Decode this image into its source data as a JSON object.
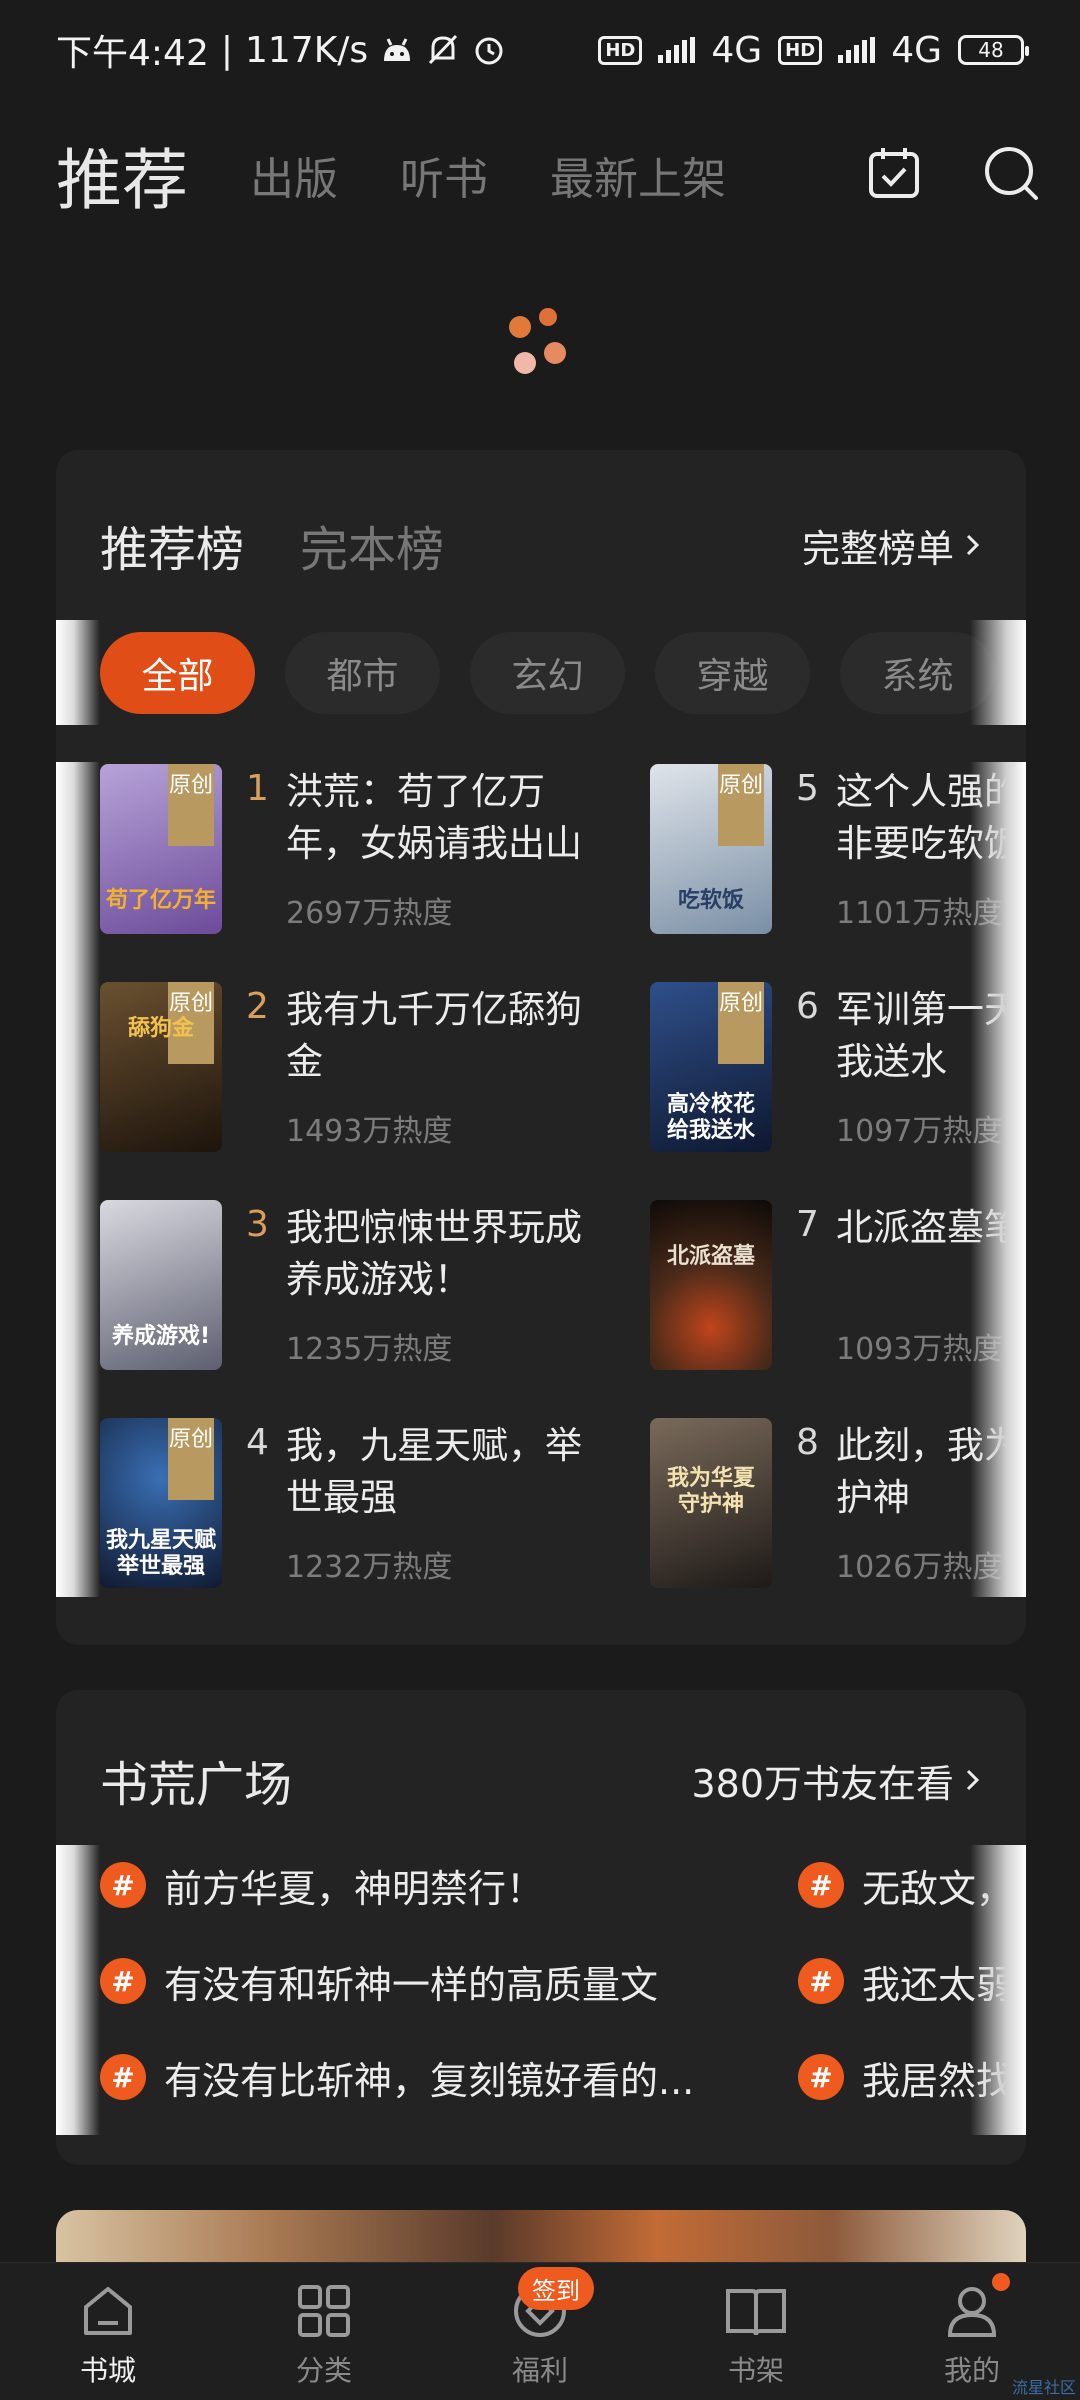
{
  "status_bar": {
    "time": "下午4:42",
    "net_speed": "117K/s",
    "net1": "4G",
    "net2": "4G",
    "hd": "HD",
    "battery": "48"
  },
  "top_tabs": [
    {
      "label": "推荐",
      "active": true
    },
    {
      "label": "出版"
    },
    {
      "label": "听书"
    },
    {
      "label": "最新上架"
    }
  ],
  "rank": {
    "tabs": [
      "推荐榜",
      "完本榜"
    ],
    "more_label": "完整榜单",
    "chips": [
      "全部",
      "都市",
      "玄幻",
      "穿越",
      "系统"
    ],
    "books": [
      {
        "rank": "1",
        "title": "洪荒：苟了亿万年，女娲请我出山",
        "heat": "2697万热度",
        "tag": "原创",
        "cover_text": "苟了亿万年",
        "c1": "#b7a3d8",
        "c2": "#6c4b9a"
      },
      {
        "rank": "2",
        "title": "我有九千万亿舔狗金",
        "heat": "1493万热度",
        "tag": "原创",
        "cover_text": "舔狗金",
        "c1": "#6a5030",
        "c2": "#1d140c"
      },
      {
        "rank": "3",
        "title": "我把惊悚世界玩成养成游戏！",
        "heat": "1235万热度",
        "tag": "",
        "cover_text": "养成游戏!",
        "c1": "#d9d9e0",
        "c2": "#5d5f70"
      },
      {
        "rank": "4",
        "title": "我，九星天赋，举世最强",
        "heat": "1232万热度",
        "tag": "原创",
        "cover_text": "我九星天赋 举世最强",
        "c1": "#3a6fb5",
        "c2": "#101a30"
      },
      {
        "rank": "5",
        "title": "这个人强的离谱却非要吃软饭",
        "heat": "1101万热度",
        "tag": "原创",
        "cover_text": "吃软饭",
        "c1": "#dfe4ea",
        "c2": "#7a8fa5"
      },
      {
        "rank": "6",
        "title": "军训第一天校花给我送水",
        "heat": "1097万热度",
        "tag": "原创",
        "cover_text": "高冷校花 给我送水",
        "c1": "#2f4f8a",
        "c2": "#0e1830"
      },
      {
        "rank": "7",
        "title": "北派盗墓笔记",
        "heat": "1093万热度",
        "tag": "",
        "cover_text": "北派盗墓",
        "c1": "#4a2a1a",
        "c2": "#0d0a08"
      },
      {
        "rank": "8",
        "title": "此刻，我为华夏守护神",
        "heat": "1026万热度",
        "tag": "",
        "cover_text": "我为华夏 守护神",
        "c1": "#7a6a5a",
        "c2": "#1e1a18"
      }
    ]
  },
  "square": {
    "title": "书荒广场",
    "more_label": "380万书友在看",
    "topics": [
      {
        "text": "前方华夏，神明禁行！"
      },
      {
        "text": "有没有和斩神一样的高质量文"
      },
      {
        "text": "有没有比斩神，复刻镜好看的..."
      },
      {
        "text": "无敌文，"
      },
      {
        "text": "我还太弱"
      },
      {
        "text": "我居然找"
      }
    ]
  },
  "bottom_nav": [
    {
      "label": "书城",
      "active": true
    },
    {
      "label": "分类"
    },
    {
      "label": "福利",
      "badge": "签到"
    },
    {
      "label": "书架"
    },
    {
      "label": "我的"
    }
  ],
  "watermark": "流星社区",
  "colors": {
    "accent": "#e04d16",
    "background": "#1b1b1b",
    "card": "#232323",
    "rank_gold": "#d9a05a"
  }
}
